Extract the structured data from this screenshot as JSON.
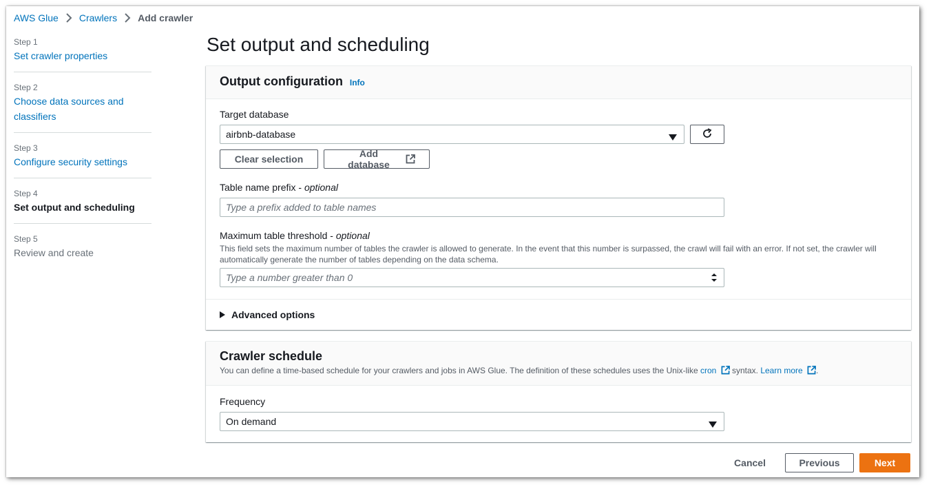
{
  "breadcrumb": {
    "items": [
      "AWS Glue",
      "Crawlers"
    ],
    "current": "Add crawler"
  },
  "steps": [
    {
      "num": "Step 1",
      "title": "Set crawler properties"
    },
    {
      "num": "Step 2",
      "title": "Choose data sources and classifiers"
    },
    {
      "num": "Step 3",
      "title": "Configure security settings"
    },
    {
      "num": "Step 4",
      "title": "Set output and scheduling"
    },
    {
      "num": "Step 5",
      "title": "Review and create"
    }
  ],
  "page_title": "Set output and scheduling",
  "output_config": {
    "title": "Output configuration",
    "info": "Info",
    "target_db_label": "Target database",
    "target_db_value": "airbnb-database",
    "clear_selection": "Clear selection",
    "add_database": "Add database",
    "prefix_label": "Table name prefix - ",
    "prefix_optional": "optional",
    "prefix_placeholder": "Type a prefix added to table names",
    "threshold_label": "Maximum table threshold - ",
    "threshold_optional": "optional",
    "threshold_desc": "This field sets the maximum number of tables the crawler is allowed to generate. In the event that this number is surpassed, the crawl will fail with an error. If not set, the crawler will automatically generate the number of tables depending on the data schema.",
    "threshold_placeholder": "Type a number greater than 0",
    "advanced": "Advanced options"
  },
  "schedule": {
    "title": "Crawler schedule",
    "desc_pre": "You can define a time-based schedule for your crawlers and jobs in AWS Glue. The definition of these schedules uses the Unix-like ",
    "cron": "cron",
    "desc_mid": " syntax. ",
    "learn_more": "Learn more",
    "desc_end": ".",
    "frequency_label": "Frequency",
    "frequency_value": "On demand"
  },
  "footer": {
    "cancel": "Cancel",
    "previous": "Previous",
    "next": "Next"
  },
  "colors": {
    "link": "#0073bb",
    "primary": "#ec7211",
    "text": "#16191f",
    "muted": "#545b64"
  }
}
